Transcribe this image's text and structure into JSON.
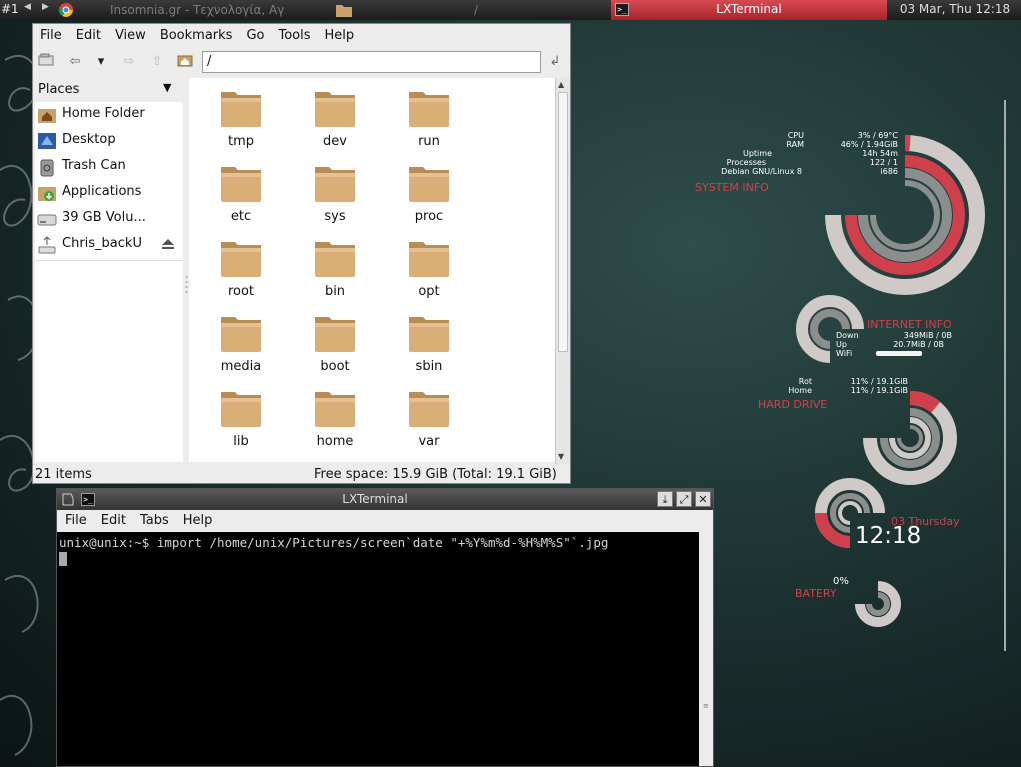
{
  "taskbar": {
    "workspace": "#1",
    "tasks": [
      {
        "label": "Insomnia.gr - Τεχνολογία, Αγ",
        "icon": "chrome-icon"
      },
      {
        "label": "/",
        "icon": "folder-icon"
      }
    ],
    "active_task": "LXTerminal",
    "clock": "03 Mar, Thu 12:18"
  },
  "file_manager": {
    "menu": [
      "File",
      "Edit",
      "View",
      "Bookmarks",
      "Go",
      "Tools",
      "Help"
    ],
    "path": "/",
    "places_header": "Places",
    "places": [
      {
        "label": "Home Folder",
        "icon": "home-folder-icon"
      },
      {
        "label": "Desktop",
        "icon": "desktop-icon"
      },
      {
        "label": "Trash Can",
        "icon": "trash-icon"
      },
      {
        "label": "Applications",
        "icon": "applications-icon"
      },
      {
        "label": "39 GB Volu...",
        "icon": "drive-icon"
      },
      {
        "label": "Chris_backU",
        "icon": "usb-drive-icon"
      }
    ],
    "folders": [
      "tmp",
      "dev",
      "run",
      "etc",
      "sys",
      "proc",
      "root",
      "bin",
      "opt",
      "media",
      "boot",
      "sbin",
      "lib",
      "home",
      "var"
    ],
    "status_items": "21 items",
    "status_space": "Free space: 15.9 GiB (Total: 19.1 GiB)"
  },
  "terminal": {
    "title": "LXTerminal",
    "menu": [
      "File",
      "Edit",
      "Tabs",
      "Help"
    ],
    "command_line": "unix@unix:~$ import /home/unix/Pictures/screen`date \"+%Y%m%d-%H%M%S\"`.jpg"
  },
  "conky": {
    "system": {
      "labels": [
        "CPU",
        "RAM",
        "Uptime",
        "Processes",
        "Debian GNU/Linux 8"
      ],
      "values": [
        "3% / 69°C",
        "46% / 1.94GiB",
        "14h 54m",
        "122 / 1",
        "i686"
      ],
      "title": "SYSTEM INFO",
      "cpu_percent": 3,
      "ram_percent": 46
    },
    "internet": {
      "labels": [
        "Down",
        "Up",
        "WiFi"
      ],
      "values": [
        "349MiB / 0B",
        "20.7MiB / 0B"
      ],
      "title": "INTERNET INFO"
    },
    "drive": {
      "labels": [
        "Rot",
        "Home"
      ],
      "values": [
        "11% / 19.1GiB",
        "11% / 19.1GiB"
      ],
      "title": "HARD DRIVE",
      "root_percent": 11
    },
    "clock": {
      "date": "03 Thursday",
      "time": "12:18"
    },
    "battery": {
      "percent": "0%",
      "title": "BATERY"
    },
    "accent": "#d0404c",
    "ring_light": "#cfc9c7",
    "ring_dark": "#8a8f8e"
  }
}
